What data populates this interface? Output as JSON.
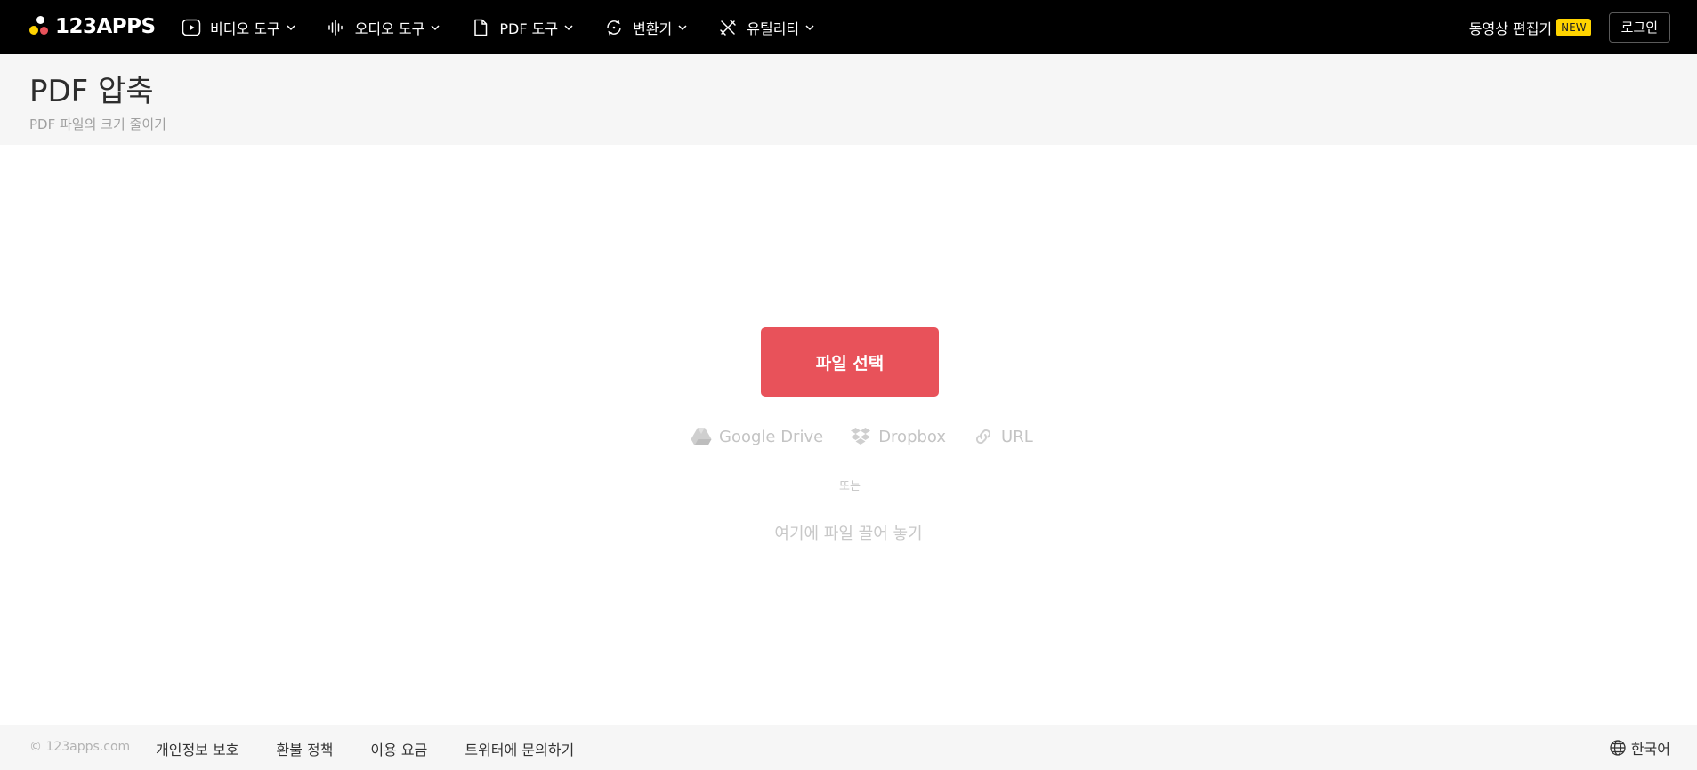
{
  "brand": {
    "logo_text": "123APPS",
    "dot_colors": [
      "#ffd400",
      "#e8525a",
      "#3b82f6"
    ]
  },
  "nav": {
    "items": [
      {
        "label": "비디오 도구",
        "icon": "play-icon"
      },
      {
        "label": "오디오 도구",
        "icon": "waveform-icon"
      },
      {
        "label": "PDF 도구",
        "icon": "document-icon"
      },
      {
        "label": "변환기",
        "icon": "convert-icon"
      },
      {
        "label": "유틸리티",
        "icon": "tools-icon"
      }
    ],
    "editor_label": "동영상 편집기",
    "new_badge": "NEW",
    "login_label": "로그인"
  },
  "page": {
    "title": "PDF 압축",
    "subtitle": "PDF 파일의 크기 줄이기"
  },
  "upload": {
    "select_button": "파일 선택",
    "accent_color": "#e8525a",
    "sources": [
      {
        "label": "Google Drive",
        "icon": "google-drive-icon"
      },
      {
        "label": "Dropbox",
        "icon": "dropbox-icon"
      },
      {
        "label": "URL",
        "icon": "link-icon"
      }
    ],
    "or_text": "또는",
    "drop_text": "여기에 파일 끌어 놓기"
  },
  "footer": {
    "copyright": "© 123apps.com",
    "links": [
      "개인정보 보호",
      "환불 정책",
      "이용 요금",
      "트위터에 문의하기"
    ],
    "language": "한국어",
    "language_icon": "globe-icon"
  }
}
